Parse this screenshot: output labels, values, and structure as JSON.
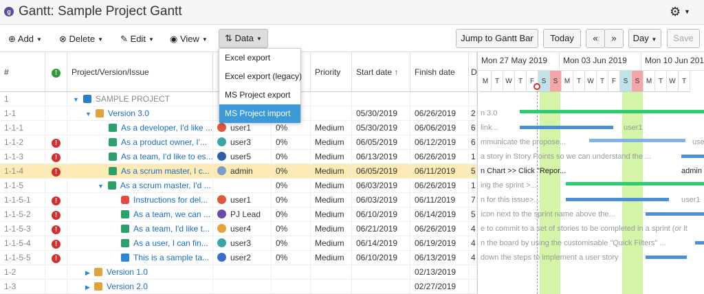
{
  "window": {
    "title": "Gantt:  Sample Project Gantt"
  },
  "toolbar": {
    "add": "Add",
    "delete": "Delete",
    "edit": "Edit",
    "view": "View",
    "data": "Data",
    "jump": "Jump to Gantt Bar",
    "today": "Today",
    "prev": "«",
    "next": "»",
    "zoom": "Day",
    "save": "Save"
  },
  "data_menu": {
    "items": [
      "Excel export",
      "Excel export (legacy)",
      "MS Project export",
      "MS Project import"
    ],
    "selected": "MS Project import"
  },
  "columns": {
    "num": "#",
    "issue": "Project/Version/Issue",
    "priority": "Priority",
    "start": "Start date",
    "finish": "Finish date",
    "dur": "D"
  },
  "rows": [
    {
      "num": "1",
      "label": "SAMPLE PROJECT",
      "assignee": "",
      "progress": "",
      "priority": "",
      "start": "",
      "finish": "",
      "d": ""
    },
    {
      "num": "1-1",
      "label": "Version 3.0",
      "assignee": "",
      "progress": "",
      "priority": "",
      "start": "05/30/2019",
      "finish": "06/26/2019",
      "d": "2"
    },
    {
      "num": "1-1-1",
      "label": "As a developer, I'd like ...",
      "assignee": "user1",
      "progress": "0%",
      "priority": "Medium",
      "start": "05/30/2019",
      "finish": "06/06/2019",
      "d": "6"
    },
    {
      "num": "1-1-2",
      "label": "As a product owner, I'...",
      "assignee": "user3",
      "progress": "0%",
      "priority": "Medium",
      "start": "06/05/2019",
      "finish": "06/12/2019",
      "d": "6"
    },
    {
      "num": "1-1-3",
      "label": "As a team, I'd like to es...",
      "assignee": "user5",
      "progress": "0%",
      "priority": "Medium",
      "start": "06/13/2019",
      "finish": "06/26/2019",
      "d": "1"
    },
    {
      "num": "1-1-4",
      "label": "As a scrum master, I c...",
      "assignee": "admin",
      "progress": "0%",
      "priority": "Medium",
      "start": "06/05/2019",
      "finish": "06/11/2019",
      "d": "5"
    },
    {
      "num": "1-1-5",
      "label": "As a scrum master, I'd ...",
      "assignee": "",
      "progress": "0%",
      "priority": "Medium",
      "start": "06/03/2019",
      "finish": "06/26/2019",
      "d": "1"
    },
    {
      "num": "1-1-5-1",
      "label": "Instructions for del...",
      "assignee": "user1",
      "progress": "0%",
      "priority": "Medium",
      "start": "06/03/2019",
      "finish": "06/11/2019",
      "d": "7"
    },
    {
      "num": "1-1-5-2",
      "label": "As a team, we can ...",
      "assignee": "PJ Lead",
      "progress": "0%",
      "priority": "Medium",
      "start": "06/10/2019",
      "finish": "06/14/2019",
      "d": "5"
    },
    {
      "num": "1-1-5-3",
      "label": "As a team, I'd like t...",
      "assignee": "user4",
      "progress": "0%",
      "priority": "Medium",
      "start": "06/21/2019",
      "finish": "06/26/2019",
      "d": "4"
    },
    {
      "num": "1-1-5-4",
      "label": "As a user, I can fin...",
      "assignee": "user3",
      "progress": "0%",
      "priority": "Medium",
      "start": "06/14/2019",
      "finish": "06/19/2019",
      "d": "4"
    },
    {
      "num": "1-1-5-5",
      "label": "This is a sample ta...",
      "assignee": "user2",
      "progress": "0%",
      "priority": "Medium",
      "start": "06/10/2019",
      "finish": "06/13/2019",
      "d": "4"
    },
    {
      "num": "1-2",
      "label": "Version 1.0",
      "assignee": "",
      "progress": "",
      "priority": "",
      "start": "",
      "finish": "02/13/2019",
      "d": ""
    },
    {
      "num": "1-3",
      "label": "Version 2.0",
      "assignee": "",
      "progress": "",
      "priority": "",
      "start": "",
      "finish": "02/27/2019",
      "d": ""
    }
  ],
  "gantt": {
    "weeks": [
      "Mon 27 May 2019",
      "Mon 03 Jun 2019",
      "Mon 10 Jun 2019"
    ],
    "days": [
      "M",
      "T",
      "W",
      "T",
      "F",
      "S",
      "S",
      "M",
      "T",
      "W",
      "T",
      "F",
      "S",
      "S",
      "M",
      "T",
      "W",
      "T"
    ],
    "labels": [
      "n 3.0",
      "link...",
      "user1",
      "mmunicate the propose...",
      "use",
      "a story in Story Points so we can understand the ...",
      "n Chart >> Click \"Repor...",
      "admin",
      "ing the sprint >...",
      "n for this issue>...",
      "user1",
      "icon next to the sprint name above the...",
      "e to commit to a set of stories to be completed in a sprint (or it",
      "n the board by using the customisable \"Quick Filters\" ...",
      "down the steps to implement a user story"
    ]
  }
}
